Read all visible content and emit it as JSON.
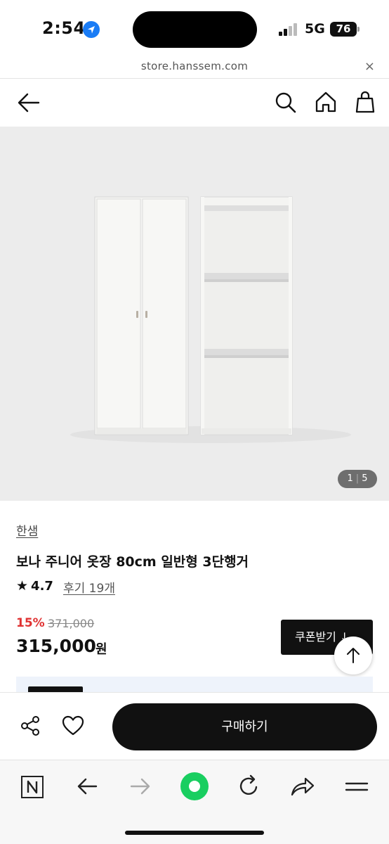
{
  "status_bar": {
    "time": "2:54",
    "network": "5G",
    "battery": "76",
    "icons": [
      "location-arrow-icon",
      "signal-bars-icon",
      "battery-icon"
    ]
  },
  "browser": {
    "url": "store.hanssem.com",
    "close_label": "×"
  },
  "header": {
    "icons": [
      "back-arrow-icon",
      "search-icon",
      "home-icon",
      "shopping-bag-icon"
    ]
  },
  "gallery": {
    "current": "1",
    "total": "5"
  },
  "product": {
    "brand": "한샘",
    "title": "보나 주니어 옷장 80cm 일반형 3단행거",
    "rating": "4.7",
    "reviews": "후기 19개",
    "discount": "15%",
    "original_price": "371,000",
    "price": "315,000",
    "currency": "원",
    "coupon_label": "쿠폰받기 ↓"
  },
  "buy_bar": {
    "buy_label": "구매하기",
    "icons": [
      "share-icon",
      "heart-icon"
    ]
  },
  "toolbar": {
    "icons": [
      "naver-n-icon",
      "back-icon",
      "forward-icon",
      "green-dot-icon",
      "reload-icon",
      "share-arrow-icon",
      "menu-icon"
    ]
  },
  "colors": {
    "discount": "#e03232",
    "accent_green": "#19ce60",
    "primary": "#111111"
  }
}
